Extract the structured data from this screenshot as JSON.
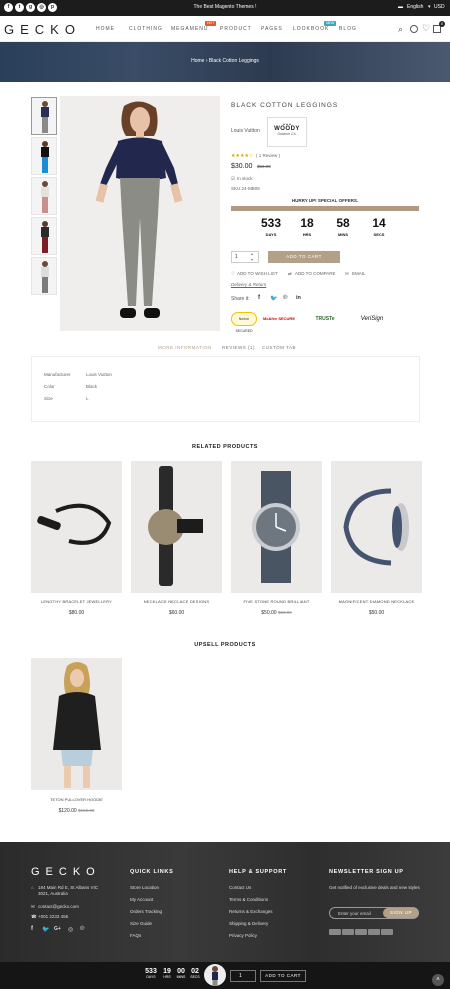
{
  "topbar": {
    "social_icons": [
      "facebook-icon",
      "twitter-icon",
      "google-plus-icon",
      "instagram-icon",
      "pinterest-icon"
    ],
    "promo": "The Best Magento Themes !",
    "language": "English",
    "currency": "USD"
  },
  "header": {
    "logo": "GECKO",
    "nav": [
      {
        "label": "HOME",
        "badge": ""
      },
      {
        "label": "CLOTHING",
        "badge": ""
      },
      {
        "label": "MEGAMENU",
        "badge": "HOT"
      },
      {
        "label": "PRODUCT",
        "badge": ""
      },
      {
        "label": "PAGES",
        "badge": ""
      },
      {
        "label": "LOOKBOOK",
        "badge": "NEW"
      },
      {
        "label": "BLOG",
        "badge": ""
      }
    ],
    "cart_count": "0"
  },
  "breadcrumb": {
    "home": "Home",
    "sep": "›",
    "current": "Black Cotton Leggings"
  },
  "product": {
    "title": "BLACK COTTON LEGGINGS",
    "brand": "Louis Vuitton",
    "brand_logo_text": "WOODY",
    "brand_logo_sub": "Outdoor Co.",
    "review_count": "1",
    "review_label": "( 1 Review )",
    "price": "$30.00",
    "old_price": "$50.00",
    "stock": "In stock",
    "sku": "SKU:24-MB06",
    "hurry": "HURRY UP! SPECIAL OFFERS.",
    "countdown": [
      {
        "value": "533",
        "label": "DAYS"
      },
      {
        "value": "18",
        "label": "HRS"
      },
      {
        "value": "58",
        "label": "MINS"
      },
      {
        "value": "14",
        "label": "SECS"
      }
    ],
    "qty": "1",
    "add_to_cart": "ADD TO CART",
    "wishlist": "ADD TO WISH LIST",
    "compare": "ADD TO COMPARE",
    "email": "EMAIL",
    "delivery": "Delivery & Return",
    "share": "Share it:",
    "trust_badges": [
      "Norton SECURED",
      "McAfee SECURE",
      "TRUSTe",
      "VeriSign"
    ]
  },
  "tabs": {
    "items": [
      "MORE INFORMATION",
      "REVIEWS (1)",
      "CUSTOM TAB"
    ],
    "info": [
      {
        "label": "Manufacturer",
        "value": "Louis Vuitton"
      },
      {
        "label": "Color",
        "value": "Black"
      },
      {
        "label": "Size",
        "value": "L"
      }
    ]
  },
  "related": {
    "title": "RELATED PRODUCTS",
    "items": [
      {
        "name": "LENGTHY BRACELET JEWELLERY",
        "price": "$80.00",
        "old": ""
      },
      {
        "name": "NECKLACE NECLACE DESIGNS",
        "price": "$60.00",
        "old": ""
      },
      {
        "name": "FIVE STONE ROUND BRILLIANT",
        "price": "$50.00",
        "old": "$80.00"
      },
      {
        "name": "MAGNIFICENT DIAMOND NECKLACE",
        "price": "$50.00",
        "old": ""
      }
    ]
  },
  "upsell": {
    "title": "UPSELL PRODUCTS",
    "items": [
      {
        "name": "TETON PULLOVER HOODIE",
        "price": "$120.00",
        "old": "$150.00"
      }
    ]
  },
  "footer": {
    "logo": "GECKO",
    "address": "184 Main Rd E, St Albans VIC 3021, Australia",
    "email": "contact@gecko.com",
    "phone": "+001 2233 456",
    "quick_links_title": "QUICK LINKS",
    "quick_links": [
      "Store Location",
      "My Account",
      "Orders Tracking",
      "Size Guide",
      "FAQs"
    ],
    "help_title": "HELP & SUPPORT",
    "help_links": [
      "Contact Us",
      "Terms & Conditions",
      "Returns & Exchanges",
      "Shipping & Delivery",
      "Privacy Policy"
    ],
    "newsletter_title": "NEWSLETTER SIGN UP",
    "newsletter_text": "Get notified of exclusive deals and new styles",
    "newsletter_placeholder": "Enter your email",
    "signup": "SIGN UP"
  },
  "sticky": {
    "countdown": [
      {
        "value": "533",
        "label": "DAYS"
      },
      {
        "value": "19",
        "label": "HRS"
      },
      {
        "value": "00",
        "label": "MINS"
      },
      {
        "value": "02",
        "label": "SECS"
      }
    ],
    "qty": "1",
    "add_to_cart": "ADD TO CART"
  },
  "colors": {
    "accent": "#b3a088",
    "dark": "#1c1c1c",
    "footer": "#333333"
  }
}
